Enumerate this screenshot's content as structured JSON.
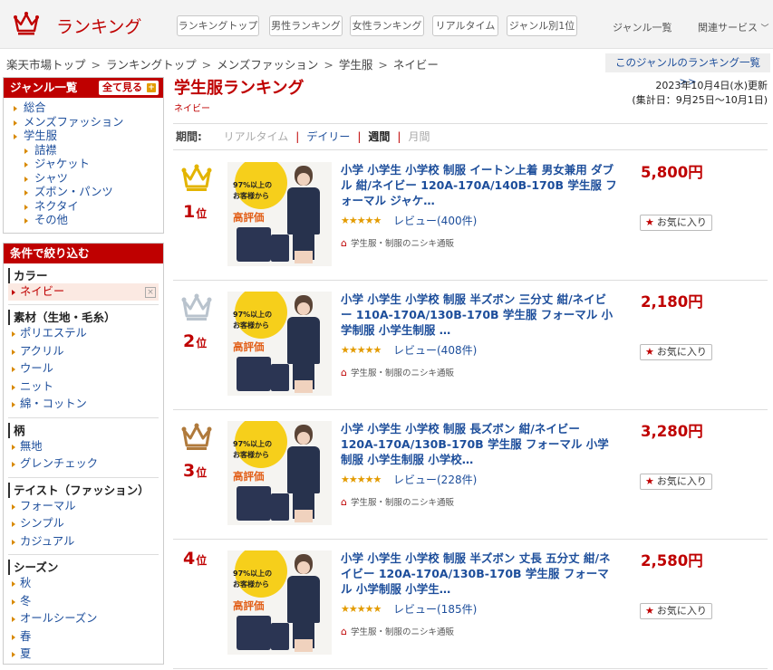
{
  "header": {
    "logo_text": "ランキング",
    "tabs": [
      "ランキングトップ",
      "男性ランキング",
      "女性ランキング",
      "リアルタイム",
      "ジャンル別1位"
    ],
    "genre_list": "ジャンル一覧",
    "related": "関連サービス"
  },
  "breadcrumb": [
    "楽天市場トップ",
    "ランキングトップ",
    "メンズファッション",
    "学生服",
    "ネイビー"
  ],
  "genre_ranking_link": "このジャンルのランキング一覧 >>",
  "sidebar": {
    "genre_title": "ジャンル一覧",
    "show_all": "全て見る",
    "genres": [
      {
        "label": "総合",
        "sub": false
      },
      {
        "label": "メンズファッション",
        "sub": false
      },
      {
        "label": "学生服",
        "sub": false
      },
      {
        "label": "詰襟",
        "sub": true
      },
      {
        "label": "ジャケット",
        "sub": true
      },
      {
        "label": "シャツ",
        "sub": true
      },
      {
        "label": "ズボン・パンツ",
        "sub": true
      },
      {
        "label": "ネクタイ",
        "sub": true
      },
      {
        "label": "その他",
        "sub": true
      }
    ],
    "filter_title": "条件で絞り込む",
    "sections": [
      {
        "title": "カラー",
        "items": [
          "ネイビー"
        ],
        "selected": 0
      },
      {
        "title": "素材（生地・毛糸）",
        "items": [
          "ポリエステル",
          "アクリル",
          "ウール",
          "ニット",
          "綿・コットン"
        ]
      },
      {
        "title": "柄",
        "items": [
          "無地",
          "グレンチェック"
        ]
      },
      {
        "title": "テイスト（ファッション）",
        "items": [
          "フォーマル",
          "シンプル",
          "カジュアル"
        ]
      },
      {
        "title": "シーズン",
        "items": [
          "秋",
          "冬",
          "オールシーズン",
          "春",
          "夏"
        ]
      }
    ]
  },
  "main": {
    "title": "学生服ランキング",
    "subtitle": "ネイビー",
    "date_line1": "2023年10月4日(水)更新",
    "date_line2": "(集計日：9月25日～10月1日)",
    "period_label": "期間:",
    "periods": [
      "リアルタイム",
      "デイリー",
      "週間",
      "月間"
    ],
    "fav_label": "お気に入り",
    "thumb_text": {
      "line1": "97%以上の",
      "line2": "お客様から",
      "line3": "高評価"
    },
    "items": [
      {
        "rank": "1",
        "rank_suffix": "位",
        "title": "小学 小学生 小学校 制服 イートン上着 男女兼用 ダブル 紺/ネイビー 120A-170A/140B-170B 学生服 フォーマル ジャケ…",
        "review": "レビュー(400件)",
        "shop": "学生服・制服のニシキ通販",
        "price": "5,800円",
        "stars": "★★★★★"
      },
      {
        "rank": "2",
        "rank_suffix": "位",
        "title": "小学 小学生 小学校 制服 半ズボン 三分丈 紺/ネイビー 110A-170A/130B-170B 学生服 フォーマル 小学制服 小学生制服 …",
        "review": "レビュー(408件)",
        "shop": "学生服・制服のニシキ通販",
        "price": "2,180円",
        "stars": "★★★★★"
      },
      {
        "rank": "3",
        "rank_suffix": "位",
        "title": "小学 小学生 小学校 制服 長ズボン 紺/ネイビー 120A-170A/130B-170B 学生服 フォーマル 小学制服 小学生制服 小学校…",
        "review": "レビュー(228件)",
        "shop": "学生服・制服のニシキ通販",
        "price": "3,280円",
        "stars": "★★★★★"
      },
      {
        "rank": "4",
        "rank_suffix": "位",
        "title": "小学 小学生 小学校 制服 半ズボン 丈長 五分丈 紺/ネイビー 120A-170A/130B-170B 学生服 フォーマル 小学制服 小学生…",
        "review": "レビュー(185件)",
        "shop": "学生服・制服のニシキ通販",
        "price": "2,580円",
        "stars": "★★★★★"
      }
    ]
  },
  "colors": {
    "accent": "#bf0000",
    "link": "#1d4e9b",
    "gold": "#e3b400",
    "silver": "#b9c3cd",
    "bronze": "#b07a3c"
  }
}
